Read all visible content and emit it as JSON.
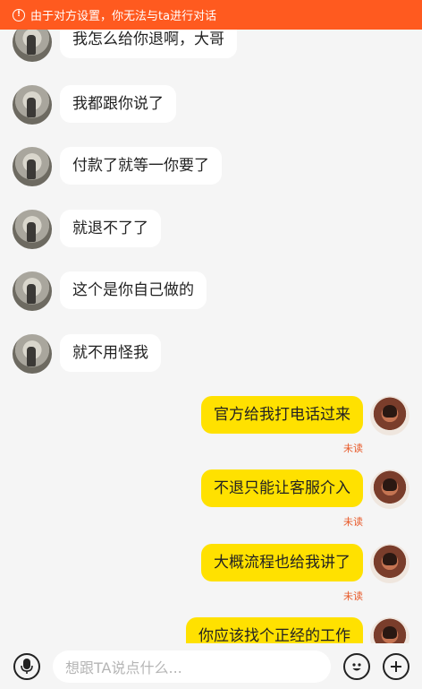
{
  "banner": {
    "text": "由于对方设置，你无法与ta进行对话"
  },
  "messages": [
    {
      "side": "left",
      "text": "我怎么给你退啊，大哥"
    },
    {
      "side": "left",
      "text": "我都跟你说了"
    },
    {
      "side": "left",
      "text": "付款了就等一你要了"
    },
    {
      "side": "left",
      "text": "就退不了了"
    },
    {
      "side": "left",
      "text": "这个是你自己做的"
    },
    {
      "side": "left",
      "text": "就不用怪我"
    },
    {
      "side": "right",
      "text": "官方给我打电话过来",
      "status": "未读"
    },
    {
      "side": "right",
      "text": "不退只能让客服介入",
      "status": "未读"
    },
    {
      "side": "right",
      "text": "大概流程也给我讲了",
      "status": "未读"
    },
    {
      "side": "right",
      "text": "你应该找个正经的工作"
    }
  ],
  "input": {
    "placeholder": "想跟TA说点什么..."
  },
  "icons": {
    "voice": "microphone-icon",
    "emoji": "emoji-icon",
    "more": "plus-icon",
    "warning": "info-circle-icon"
  }
}
